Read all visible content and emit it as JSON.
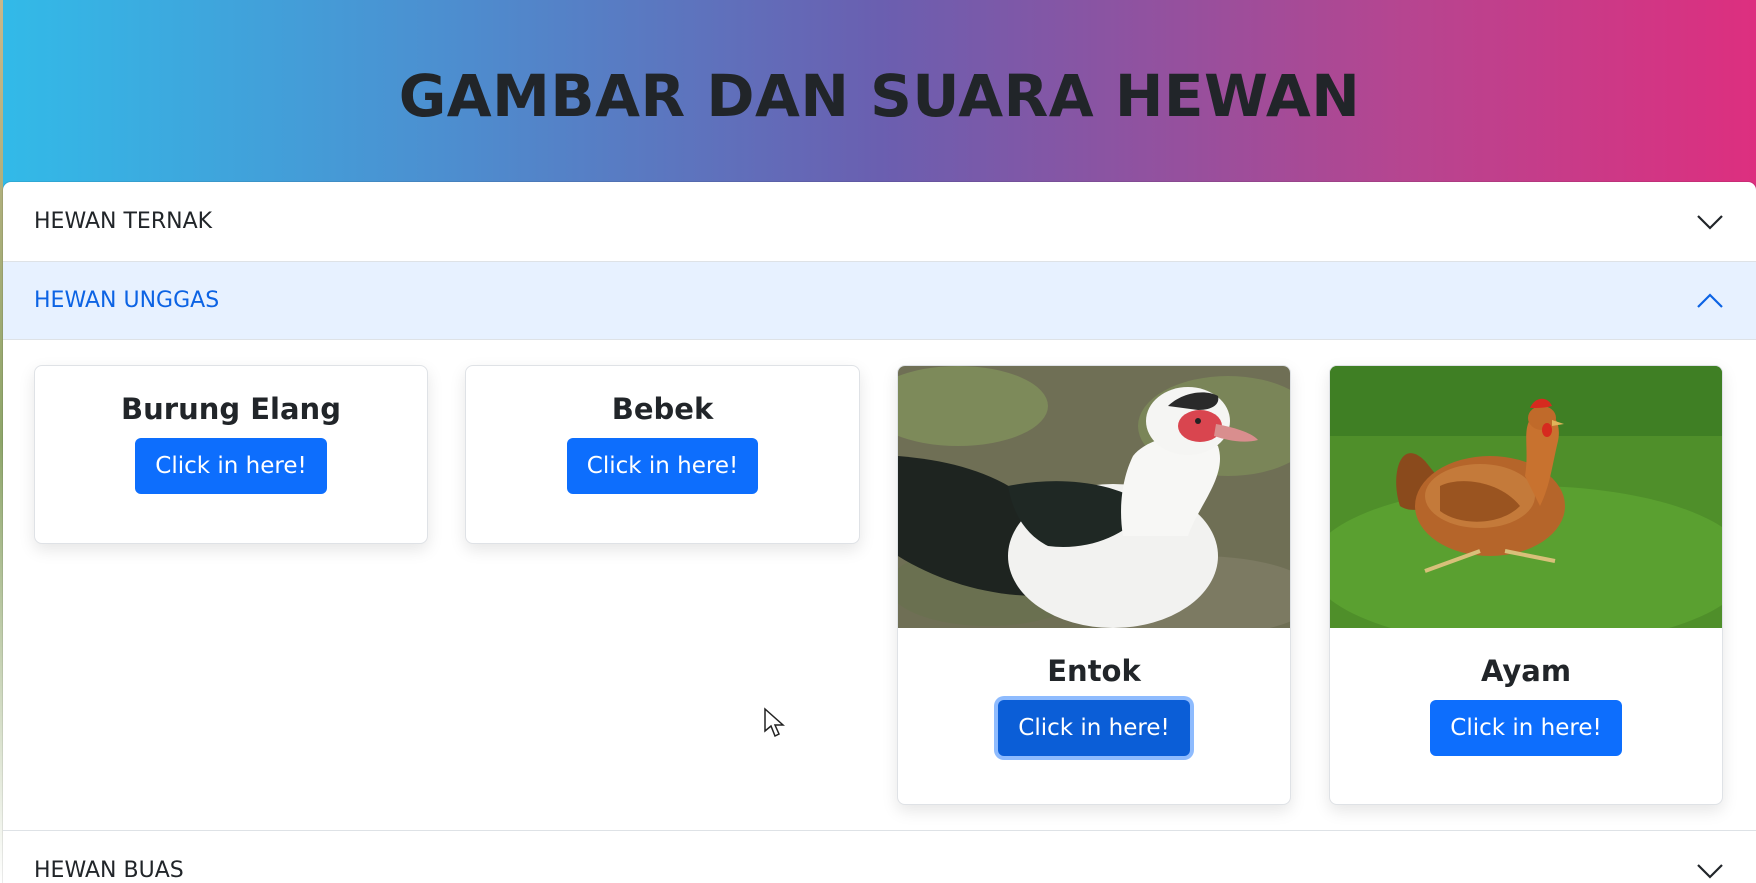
{
  "page": {
    "title": "GAMBAR DAN SUARA HEWAN"
  },
  "accordion": {
    "sections": [
      {
        "label": "HEWAN TERNAK",
        "expanded": false,
        "icon": "chevron-down-icon"
      },
      {
        "label": "HEWAN UNGGAS",
        "expanded": true,
        "icon": "chevron-up-icon"
      },
      {
        "label": "HEWAN BUAS",
        "expanded": false,
        "icon": "chevron-down-icon"
      }
    ]
  },
  "cards": [
    {
      "title": "Burung Elang",
      "button": "Click in here!",
      "has_image": false
    },
    {
      "title": "Bebek",
      "button": "Click in here!",
      "has_image": false
    },
    {
      "title": "Entok",
      "button": "Click in here!",
      "has_image": true,
      "image": "muscovy-duck-photo",
      "focused": true
    },
    {
      "title": "Ayam",
      "button": "Click in here!",
      "has_image": true,
      "image": "chicken-photo"
    }
  ],
  "colors": {
    "primary": "#0d6efd",
    "active_header_bg": "#e7f1ff",
    "active_header_text": "#0c63e4",
    "gradient_start": "#32bae8",
    "gradient_end": "#dd2f7f"
  }
}
